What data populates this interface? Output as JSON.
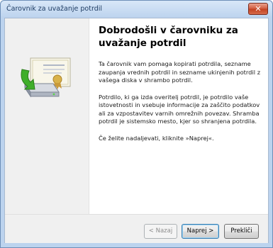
{
  "window": {
    "title": "Čarovnik za uvažanje potrdil",
    "close_label": "✕"
  },
  "main": {
    "heading": "Dobrodošli v čarovniku za uvažanje potrdil",
    "paragraphs": [
      "Ta čarovnik vam pomaga kopirati potrdila, sezname zaupanja vrednih potrdil in sezname ukinjenih potrdil z vašega diska v shrambo potrdil.",
      "Potrdilo, ki ga izda overitelj potrdil, je potrdilo vaše istovetnosti in vsebuje informacije za zaščito podatkov ali za vzpostavitev varnih omrežnih povezav. Shramba potrdil je sistemsko mesto, kjer so shranjena potrdila.",
      "Če želite nadaljevati, kliknite »Naprej«."
    ]
  },
  "buttons": {
    "back": "< Nazaj",
    "next": "Naprej >",
    "cancel": "Prekliči"
  },
  "colors": {
    "titlebar": "#bcd3ee",
    "close_button": "#c94f33",
    "default_button_border": "#3c7fb1"
  }
}
